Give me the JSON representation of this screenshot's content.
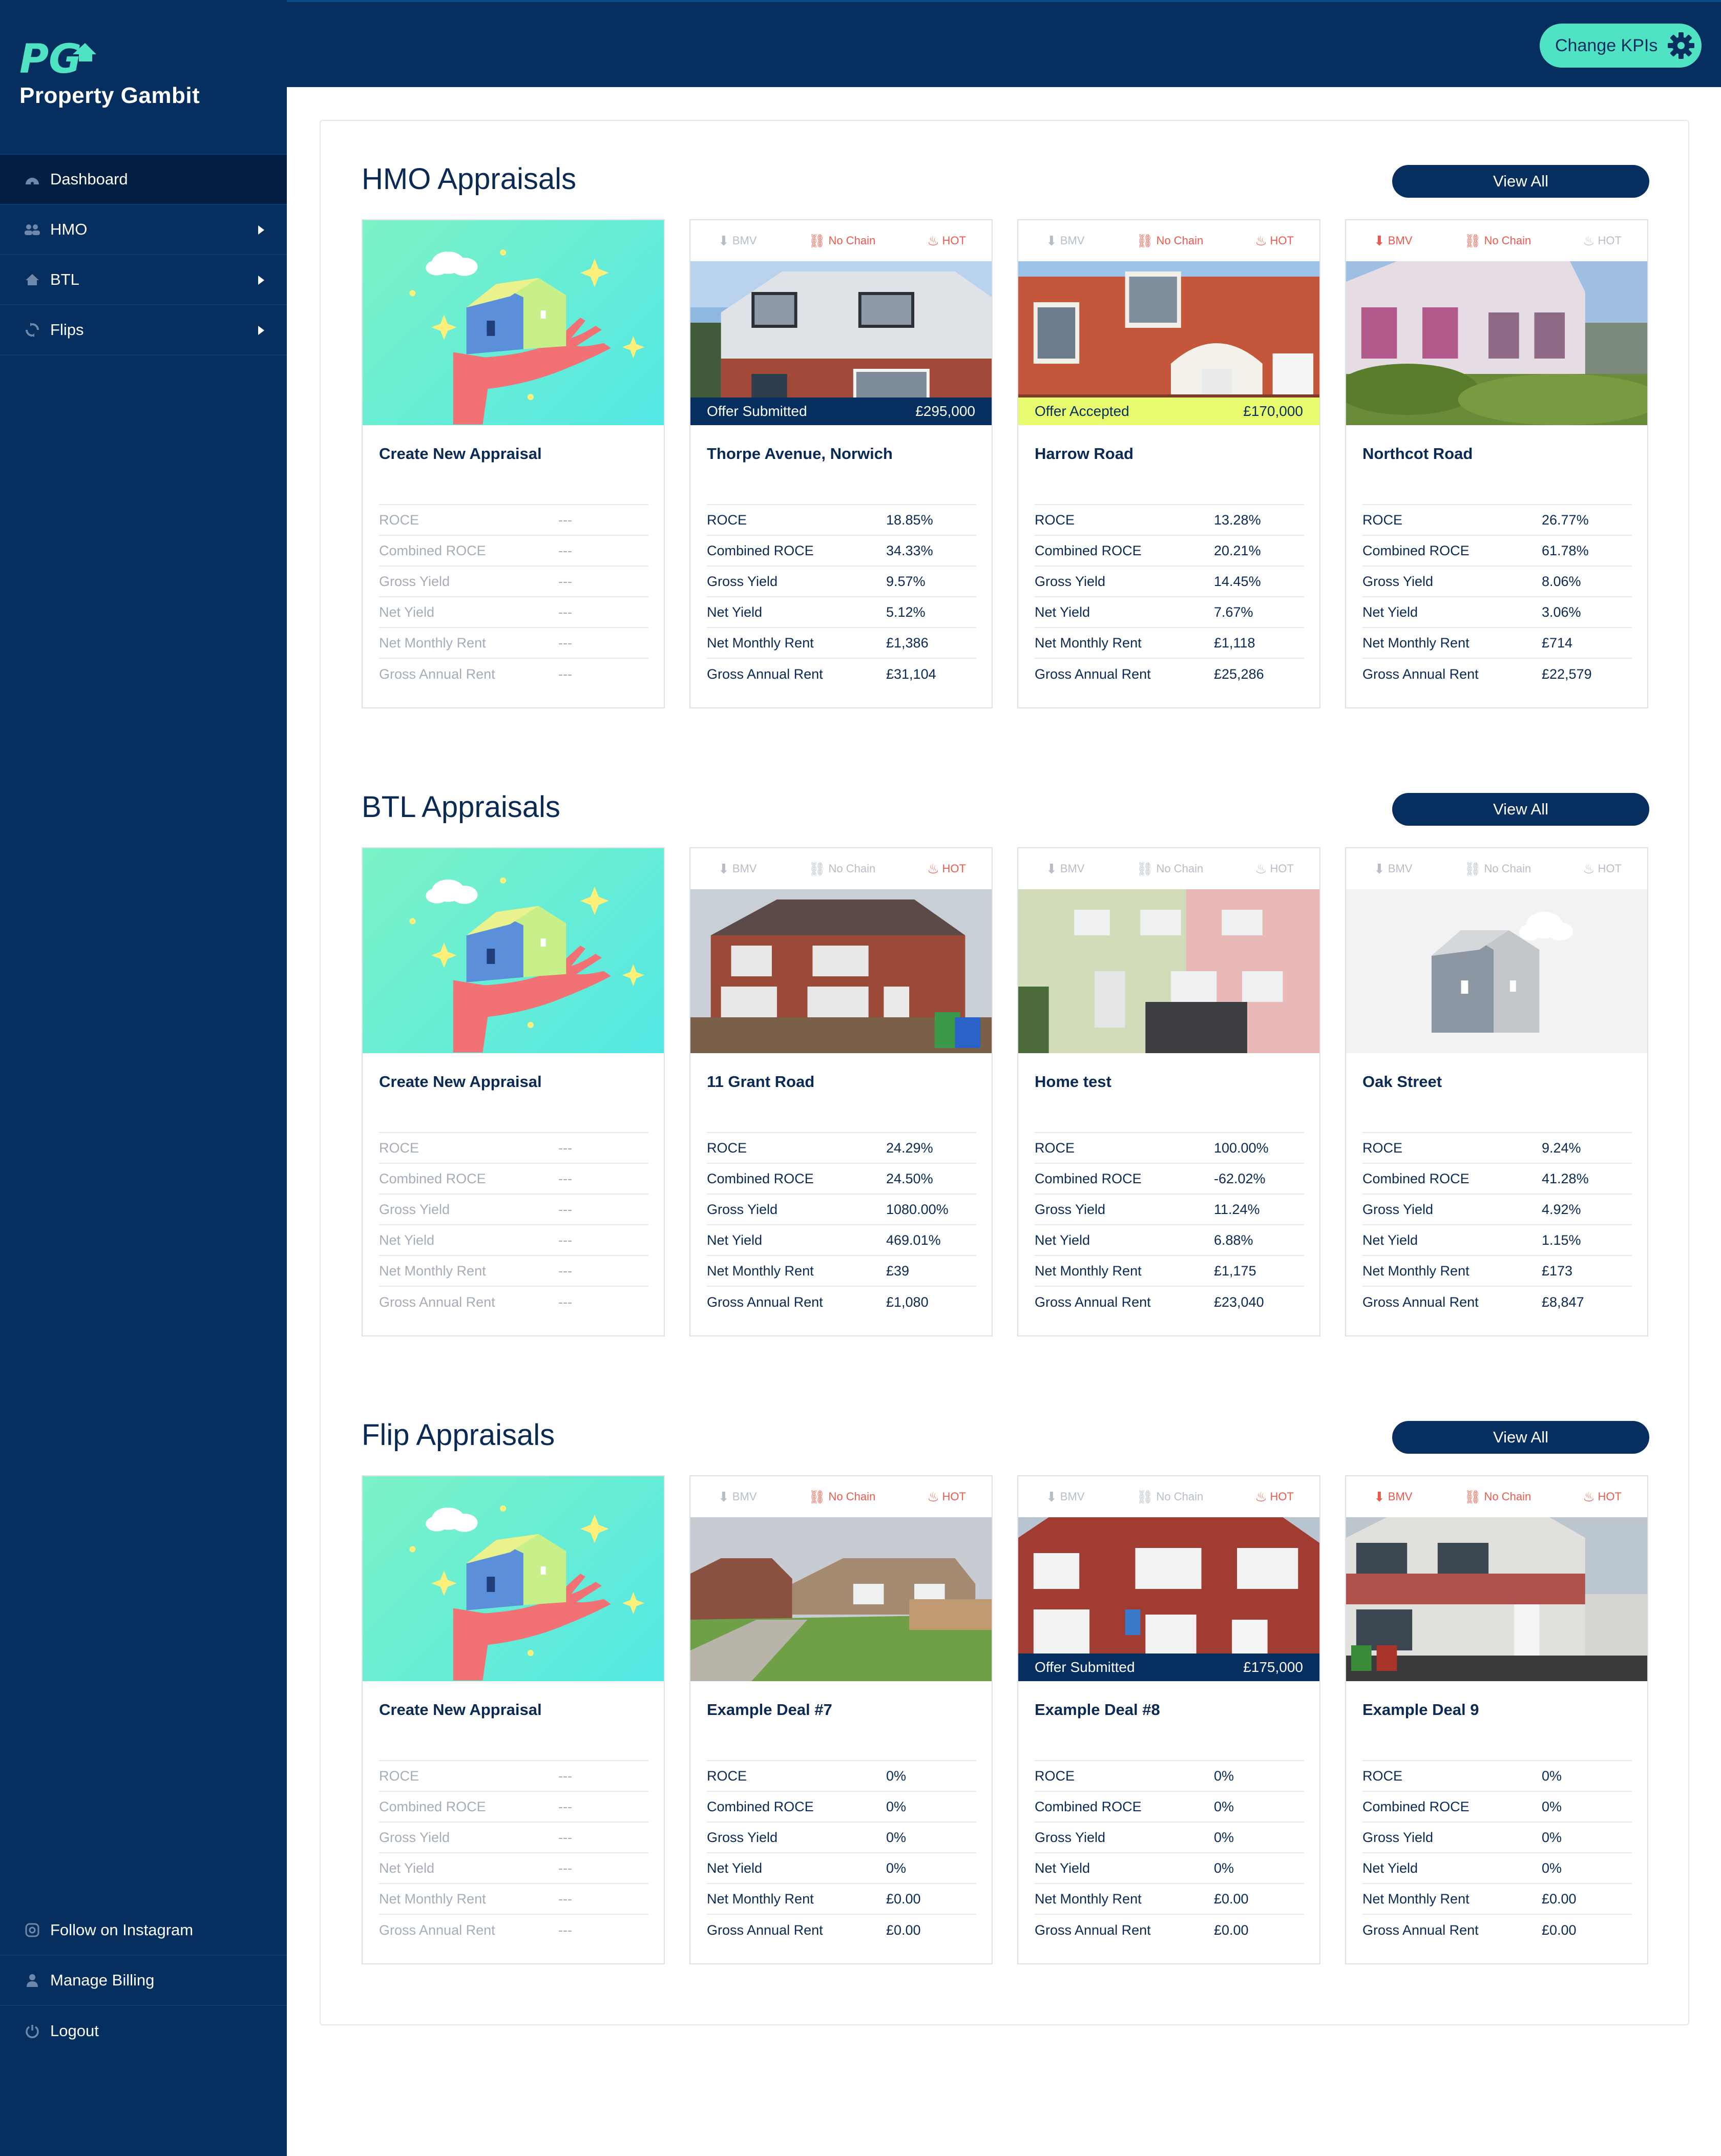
{
  "app": {
    "brand": "Property Gambit",
    "logo_text": "PG"
  },
  "header": {
    "kpi_button": "Change KPIs"
  },
  "sidebar": {
    "items": [
      {
        "label": "Dashboard",
        "icon": "dashboard-icon"
      },
      {
        "label": "HMO",
        "icon": "users-icon"
      },
      {
        "label": "BTL",
        "icon": "home-icon"
      },
      {
        "label": "Flips",
        "icon": "sync-icon"
      }
    ],
    "bottom": [
      {
        "label": "Follow on Instagram",
        "icon": "instagram-icon"
      },
      {
        "label": "Manage Billing",
        "icon": "user-icon"
      },
      {
        "label": "Logout",
        "icon": "power-icon"
      }
    ]
  },
  "tags": {
    "bmv": "BMV",
    "nochain": "No Chain",
    "hot": "HOT"
  },
  "create_card": {
    "title": "Create New Appraisal",
    "rows": [
      {
        "k": "ROCE",
        "v": "---"
      },
      {
        "k": "Combined ROCE",
        "v": "---"
      },
      {
        "k": "Gross Yield",
        "v": "---"
      },
      {
        "k": "Net Yield",
        "v": "---"
      },
      {
        "k": "Net Monthly Rent",
        "v": "---"
      },
      {
        "k": "Gross Annual Rent",
        "v": "---"
      }
    ]
  },
  "colors": {
    "navy": "#062f5f",
    "teal": "#4fe3c4",
    "hot_red": "#ea5a4e",
    "offer_accepted": "#e8fb6e"
  },
  "sections": [
    {
      "title": "HMO Appraisals",
      "view_all": "View All",
      "deals": [
        {
          "name": "Thorpe Avenue, Norwich",
          "bmv": false,
          "nochain": true,
          "hot": true,
          "status": "Offer Submitted",
          "price": "£295,000",
          "status_style": "dark",
          "rows": [
            {
              "k": "ROCE",
              "v": "18.85%"
            },
            {
              "k": "Combined ROCE",
              "v": "34.33%"
            },
            {
              "k": "Gross Yield",
              "v": "9.57%"
            },
            {
              "k": "Net Yield",
              "v": "5.12%"
            },
            {
              "k": "Net Monthly Rent",
              "v": "£1,386"
            },
            {
              "k": "Gross Annual Rent",
              "v": "£31,104"
            }
          ]
        },
        {
          "name": "Harrow Road",
          "bmv": false,
          "nochain": true,
          "hot": true,
          "status": "Offer Accepted",
          "price": "£170,000",
          "status_style": "lime",
          "rows": [
            {
              "k": "ROCE",
              "v": "13.28%"
            },
            {
              "k": "Combined ROCE",
              "v": "20.21%"
            },
            {
              "k": "Gross Yield",
              "v": "14.45%"
            },
            {
              "k": "Net Yield",
              "v": "7.67%"
            },
            {
              "k": "Net Monthly Rent",
              "v": "£1,118"
            },
            {
              "k": "Gross Annual Rent",
              "v": "£25,286"
            }
          ]
        },
        {
          "name": "Northcot Road",
          "bmv": true,
          "nochain": true,
          "hot": false,
          "status": "",
          "price": "",
          "status_style": "",
          "rows": [
            {
              "k": "ROCE",
              "v": "26.77%"
            },
            {
              "k": "Combined ROCE",
              "v": "61.78%"
            },
            {
              "k": "Gross Yield",
              "v": "8.06%"
            },
            {
              "k": "Net Yield",
              "v": "3.06%"
            },
            {
              "k": "Net Monthly Rent",
              "v": "£714"
            },
            {
              "k": "Gross Annual Rent",
              "v": "£22,579"
            }
          ]
        }
      ]
    },
    {
      "title": "BTL Appraisals",
      "view_all": "View All",
      "deals": [
        {
          "name": "11 Grant Road",
          "bmv": false,
          "nochain": false,
          "hot": true,
          "status": "",
          "price": "",
          "status_style": "",
          "rows": [
            {
              "k": "ROCE",
              "v": "24.29%"
            },
            {
              "k": "Combined ROCE",
              "v": "24.50%"
            },
            {
              "k": "Gross Yield",
              "v": "1080.00%"
            },
            {
              "k": "Net Yield",
              "v": "469.01%"
            },
            {
              "k": "Net Monthly Rent",
              "v": "£39"
            },
            {
              "k": "Gross Annual Rent",
              "v": "£1,080"
            }
          ]
        },
        {
          "name": "Home test",
          "bmv": false,
          "nochain": false,
          "hot": false,
          "status": "",
          "price": "",
          "status_style": "",
          "rows": [
            {
              "k": "ROCE",
              "v": "100.00%"
            },
            {
              "k": "Combined ROCE",
              "v": "-62.02%"
            },
            {
              "k": "Gross Yield",
              "v": "11.24%"
            },
            {
              "k": "Net Yield",
              "v": "6.88%"
            },
            {
              "k": "Net Monthly Rent",
              "v": "£1,175"
            },
            {
              "k": "Gross Annual Rent",
              "v": "£23,040"
            }
          ]
        },
        {
          "name": "Oak Street",
          "bmv": false,
          "nochain": false,
          "hot": false,
          "status": "",
          "price": "",
          "status_style": "",
          "rows": [
            {
              "k": "ROCE",
              "v": "9.24%"
            },
            {
              "k": "Combined ROCE",
              "v": "41.28%"
            },
            {
              "k": "Gross Yield",
              "v": "4.92%"
            },
            {
              "k": "Net Yield",
              "v": "1.15%"
            },
            {
              "k": "Net Monthly Rent",
              "v": "£173"
            },
            {
              "k": "Gross Annual Rent",
              "v": "£8,847"
            }
          ]
        }
      ]
    },
    {
      "title": "Flip Appraisals",
      "view_all": "View All",
      "deals": [
        {
          "name": "Example Deal #7",
          "bmv": false,
          "nochain": true,
          "hot": true,
          "status": "",
          "price": "",
          "status_style": "",
          "rows": [
            {
              "k": "ROCE",
              "v": "0%"
            },
            {
              "k": "Combined ROCE",
              "v": "0%"
            },
            {
              "k": "Gross Yield",
              "v": "0%"
            },
            {
              "k": "Net Yield",
              "v": "0%"
            },
            {
              "k": "Net Monthly Rent",
              "v": "£0.00"
            },
            {
              "k": "Gross Annual Rent",
              "v": "£0.00"
            }
          ]
        },
        {
          "name": "Example Deal #8",
          "bmv": false,
          "nochain": false,
          "hot": true,
          "status": "Offer Submitted",
          "price": "£175,000",
          "status_style": "dark",
          "rows": [
            {
              "k": "ROCE",
              "v": "0%"
            },
            {
              "k": "Combined ROCE",
              "v": "0%"
            },
            {
              "k": "Gross Yield",
              "v": "0%"
            },
            {
              "k": "Net Yield",
              "v": "0%"
            },
            {
              "k": "Net Monthly Rent",
              "v": "£0.00"
            },
            {
              "k": "Gross Annual Rent",
              "v": "£0.00"
            }
          ]
        },
        {
          "name": "Example Deal 9",
          "bmv": true,
          "nochain": true,
          "hot": true,
          "status": "",
          "price": "",
          "status_style": "",
          "rows": [
            {
              "k": "ROCE",
              "v": "0%"
            },
            {
              "k": "Combined ROCE",
              "v": "0%"
            },
            {
              "k": "Gross Yield",
              "v": "0%"
            },
            {
              "k": "Net Yield",
              "v": "0%"
            },
            {
              "k": "Net Monthly Rent",
              "v": "£0.00"
            },
            {
              "k": "Gross Annual Rent",
              "v": "£0.00"
            }
          ]
        }
      ]
    }
  ]
}
